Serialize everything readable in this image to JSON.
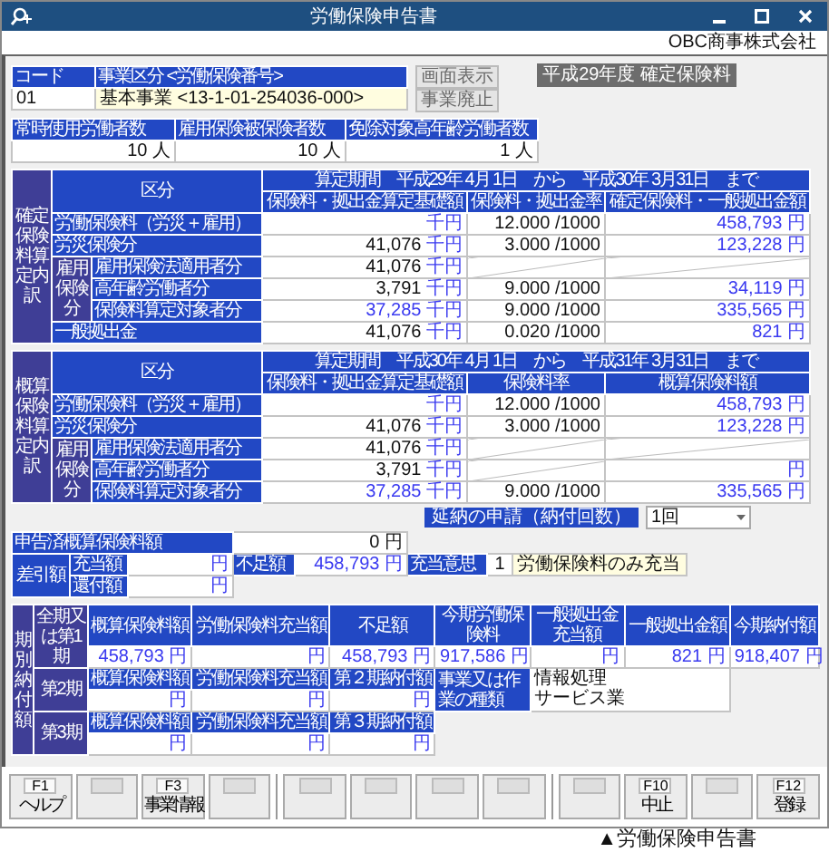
{
  "window": {
    "title": "労働保険申告書"
  },
  "company": "OBC商事株式会社",
  "office": {
    "columns": [
      "コード",
      "事業区分 <労働保険番号>"
    ],
    "code": "01",
    "division": "基本事業 <13-1-01-254036-000>"
  },
  "side_buttons": [
    {
      "label": "画面表示",
      "disabled": true
    },
    {
      "label": "事業廃止",
      "disabled": true
    }
  ],
  "year_badge": "平成29年度 確定保険料",
  "workers": [
    {
      "label": "常時使用労働者数",
      "value": "10",
      "unit": "人"
    },
    {
      "label": "雇用保険被保険者数",
      "value": "10",
      "unit": "人"
    },
    {
      "label": "免除対象高年齢労働者数",
      "value": "1",
      "unit": "人"
    }
  ],
  "sections": [
    {
      "side_label": "確定保険料算定内訳",
      "category_header": "区分",
      "period": "算定期間　平成29年 4月 1日　から　平成30年 3月31日　まで",
      "columns": [
        "保険料・拠出金算定基礎額",
        "保険料・拠出金率",
        "確定保険料・一般拠出金額"
      ],
      "group_label": "雇用保険分",
      "rows": [
        {
          "label": "労働保険料（労災＋雇用）",
          "grouped": false,
          "base": {
            "unit": "千円"
          },
          "rate": {
            "value": "12.000",
            "unit": "/1000"
          },
          "amount": {
            "value": "458,793",
            "unit": "円",
            "auto": true
          }
        },
        {
          "label": "労災保険分",
          "grouped": false,
          "base": {
            "value": "41,076",
            "unit": "千円",
            "auto": false
          },
          "rate": {
            "value": "3.000",
            "unit": "/1000"
          },
          "amount": {
            "value": "123,228",
            "unit": "円",
            "auto": true
          }
        },
        {
          "label": "雇用保険法適用者分",
          "grouped": true,
          "base": {
            "value": "41,076",
            "unit": "千円",
            "auto": false
          },
          "rate": {
            "na": true
          },
          "amount": {
            "na": true
          }
        },
        {
          "label": "高年齢労働者分",
          "grouped": true,
          "base": {
            "value": "3,791",
            "unit": "千円",
            "auto": false
          },
          "rate": {
            "value": "9.000",
            "unit": "/1000"
          },
          "amount": {
            "value": "34,119",
            "unit": "円",
            "auto": true
          }
        },
        {
          "label": "保険料算定対象者分",
          "grouped": true,
          "base": {
            "value": "37,285",
            "unit": "千円",
            "auto": true
          },
          "rate": {
            "value": "9.000",
            "unit": "/1000"
          },
          "amount": {
            "value": "335,565",
            "unit": "円",
            "auto": true
          }
        },
        {
          "label": "一般拠出金",
          "grouped": false,
          "base": {
            "value": "41,076",
            "unit": "千円",
            "auto": false
          },
          "rate": {
            "value": "0.020",
            "unit": "/1000"
          },
          "amount": {
            "value": "821",
            "unit": "円",
            "auto": true
          }
        }
      ]
    },
    {
      "side_label": "概算保険料算定内訳",
      "category_header": "区分",
      "period": "算定期間　平成30年 4月 1日　から　平成31年 3月31日　まで",
      "columns": [
        "保険料・拠出金算定基礎額",
        "保険料率",
        "概算保険料額"
      ],
      "group_label": "雇用保険分",
      "rows": [
        {
          "label": "労働保険料（労災＋雇用）",
          "grouped": false,
          "base": {
            "unit": "千円"
          },
          "rate": {
            "value": "12.000",
            "unit": "/1000"
          },
          "amount": {
            "value": "458,793",
            "unit": "円",
            "auto": true
          }
        },
        {
          "label": "労災保険分",
          "grouped": false,
          "base": {
            "value": "41,076",
            "unit": "千円",
            "auto": false
          },
          "rate": {
            "value": "3.000",
            "unit": "/1000"
          },
          "amount": {
            "value": "123,228",
            "unit": "円",
            "auto": true
          }
        },
        {
          "label": "雇用保険法適用者分",
          "grouped": true,
          "base": {
            "value": "41,076",
            "unit": "千円",
            "auto": false
          },
          "rate": {
            "na": true
          },
          "amount": {
            "na": true
          }
        },
        {
          "label": "高年齢労働者分",
          "grouped": true,
          "base": {
            "value": "3,791",
            "unit": "千円",
            "auto": false
          },
          "rate": {
            "na": true
          },
          "amount": {
            "unit": "円"
          }
        },
        {
          "label": "保険料算定対象者分",
          "grouped": true,
          "base": {
            "value": "37,285",
            "unit": "千円",
            "auto": true
          },
          "rate": {
            "value": "9.000",
            "unit": "/1000"
          },
          "amount": {
            "value": "335,565",
            "unit": "円",
            "auto": true
          }
        }
      ]
    }
  ],
  "deferral": {
    "label": "延納の申請（納付回数）",
    "value": "1回"
  },
  "filed": {
    "label": "申告済概算保険料額",
    "value": "0",
    "unit": "円",
    "diff_label": "差引額",
    "appropriation": {
      "label": "充当額",
      "unit": "円"
    },
    "refund": {
      "label": "還付額",
      "unit": "円"
    },
    "shortage": {
      "label": "不足額",
      "value": "458,793",
      "unit": "円"
    },
    "intent": {
      "label": "充当意思",
      "code": "1",
      "text": "労働保険料のみ充当"
    }
  },
  "installments": {
    "side_label": "期別納付額",
    "periods": [
      {
        "label": "全期又は第1期",
        "cells": [
          {
            "header": "概算保険料額",
            "value": "458,793",
            "unit": "円"
          },
          {
            "header": "労働保険料充当額",
            "unit": "円"
          },
          {
            "header": "不足額",
            "value": "458,793",
            "unit": "円"
          },
          {
            "header": "今期労働保険料",
            "value": "917,586",
            "unit": "円"
          },
          {
            "header": "一般拠出金充当額",
            "unit": "円"
          },
          {
            "header": "一般拠出金額",
            "value": "821",
            "unit": "円"
          },
          {
            "header": "今期納付額",
            "value": "918,407",
            "unit": "円"
          }
        ]
      },
      {
        "label": "第2期",
        "cells": [
          {
            "header": "概算保険料額",
            "unit": "円"
          },
          {
            "header": "労働保険料充当額",
            "unit": "円"
          },
          {
            "header": "第２期納付額",
            "unit": "円"
          }
        ]
      },
      {
        "label": "第3期",
        "cells": [
          {
            "header": "概算保険料額",
            "unit": "円"
          },
          {
            "header": "労働保険料充当額",
            "unit": "円"
          },
          {
            "header": "第３期納付額",
            "unit": "円"
          }
        ]
      }
    ],
    "business_type": {
      "label": "事業又は作業の種類",
      "lines": [
        "情報処理",
        "サービス業"
      ]
    }
  },
  "function_key_groups": [
    [
      {
        "kind": "assigned",
        "key": "F1",
        "label": "ヘルプ"
      },
      {
        "kind": "empty"
      },
      {
        "kind": "assigned",
        "key": "F3",
        "label": "事業情報"
      },
      {
        "kind": "empty"
      }
    ],
    [
      {
        "kind": "empty"
      },
      {
        "kind": "empty"
      },
      {
        "kind": "empty"
      },
      {
        "kind": "empty"
      }
    ],
    [
      {
        "kind": "empty"
      },
      {
        "kind": "assigned",
        "key": "F10",
        "label": "中止"
      },
      {
        "kind": "empty"
      },
      {
        "kind": "assigned",
        "key": "F12",
        "label": "登録"
      }
    ]
  ],
  "caption": "▲労働保険申告書"
}
